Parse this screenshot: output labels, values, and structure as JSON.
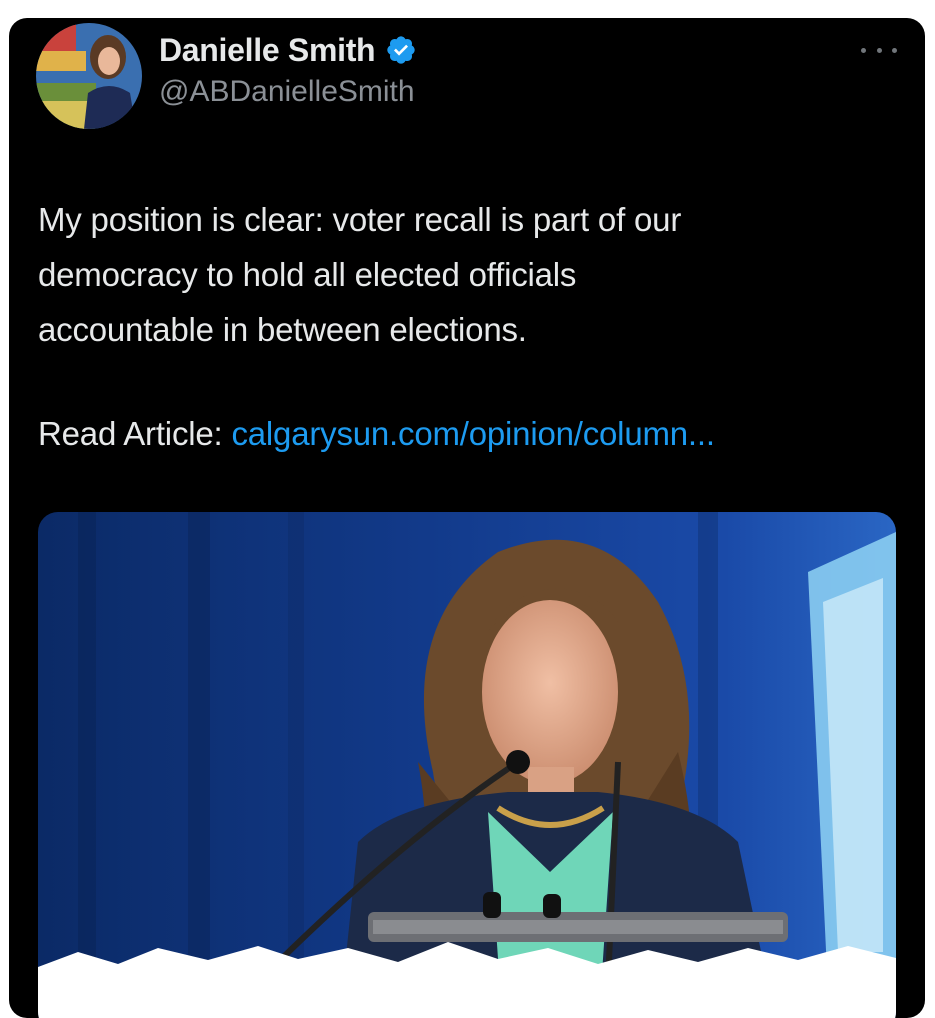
{
  "tweet": {
    "author": {
      "display_name": "Danielle Smith",
      "verified": true,
      "handle": "@ABDanielleSmith"
    },
    "body_lines": [
      "My position is clear: voter recall is part of our",
      "democracy to hold all elected officials",
      "accountable in between elections."
    ],
    "article_prefix": "Read Article:",
    "article_link_text": "calgarysun.com/opinion/column...",
    "more_icon": "more-horizontal-icon",
    "badge_icon": "verified-badge-icon"
  },
  "colors": {
    "card_background": "#000000",
    "text_primary": "#e7e9ea",
    "text_secondary": "#8b9096",
    "link": "#1d9bf0",
    "verified_badge": "#1d9bf0"
  }
}
